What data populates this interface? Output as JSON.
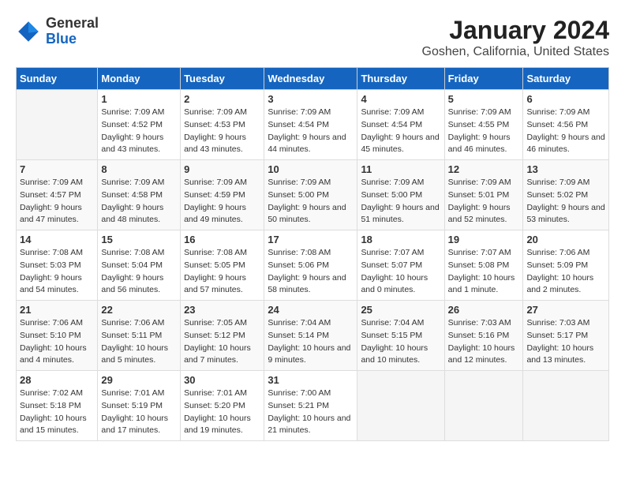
{
  "logo": {
    "general": "General",
    "blue": "Blue"
  },
  "title": "January 2024",
  "subtitle": "Goshen, California, United States",
  "headers": [
    "Sunday",
    "Monday",
    "Tuesday",
    "Wednesday",
    "Thursday",
    "Friday",
    "Saturday"
  ],
  "weeks": [
    [
      {
        "day": "",
        "sunrise": "",
        "sunset": "",
        "daylight": ""
      },
      {
        "day": "1",
        "sunrise": "Sunrise: 7:09 AM",
        "sunset": "Sunset: 4:52 PM",
        "daylight": "Daylight: 9 hours and 43 minutes."
      },
      {
        "day": "2",
        "sunrise": "Sunrise: 7:09 AM",
        "sunset": "Sunset: 4:53 PM",
        "daylight": "Daylight: 9 hours and 43 minutes."
      },
      {
        "day": "3",
        "sunrise": "Sunrise: 7:09 AM",
        "sunset": "Sunset: 4:54 PM",
        "daylight": "Daylight: 9 hours and 44 minutes."
      },
      {
        "day": "4",
        "sunrise": "Sunrise: 7:09 AM",
        "sunset": "Sunset: 4:54 PM",
        "daylight": "Daylight: 9 hours and 45 minutes."
      },
      {
        "day": "5",
        "sunrise": "Sunrise: 7:09 AM",
        "sunset": "Sunset: 4:55 PM",
        "daylight": "Daylight: 9 hours and 46 minutes."
      },
      {
        "day": "6",
        "sunrise": "Sunrise: 7:09 AM",
        "sunset": "Sunset: 4:56 PM",
        "daylight": "Daylight: 9 hours and 46 minutes."
      }
    ],
    [
      {
        "day": "7",
        "sunrise": "Sunrise: 7:09 AM",
        "sunset": "Sunset: 4:57 PM",
        "daylight": "Daylight: 9 hours and 47 minutes."
      },
      {
        "day": "8",
        "sunrise": "Sunrise: 7:09 AM",
        "sunset": "Sunset: 4:58 PM",
        "daylight": "Daylight: 9 hours and 48 minutes."
      },
      {
        "day": "9",
        "sunrise": "Sunrise: 7:09 AM",
        "sunset": "Sunset: 4:59 PM",
        "daylight": "Daylight: 9 hours and 49 minutes."
      },
      {
        "day": "10",
        "sunrise": "Sunrise: 7:09 AM",
        "sunset": "Sunset: 5:00 PM",
        "daylight": "Daylight: 9 hours and 50 minutes."
      },
      {
        "day": "11",
        "sunrise": "Sunrise: 7:09 AM",
        "sunset": "Sunset: 5:00 PM",
        "daylight": "Daylight: 9 hours and 51 minutes."
      },
      {
        "day": "12",
        "sunrise": "Sunrise: 7:09 AM",
        "sunset": "Sunset: 5:01 PM",
        "daylight": "Daylight: 9 hours and 52 minutes."
      },
      {
        "day": "13",
        "sunrise": "Sunrise: 7:09 AM",
        "sunset": "Sunset: 5:02 PM",
        "daylight": "Daylight: 9 hours and 53 minutes."
      }
    ],
    [
      {
        "day": "14",
        "sunrise": "Sunrise: 7:08 AM",
        "sunset": "Sunset: 5:03 PM",
        "daylight": "Daylight: 9 hours and 54 minutes."
      },
      {
        "day": "15",
        "sunrise": "Sunrise: 7:08 AM",
        "sunset": "Sunset: 5:04 PM",
        "daylight": "Daylight: 9 hours and 56 minutes."
      },
      {
        "day": "16",
        "sunrise": "Sunrise: 7:08 AM",
        "sunset": "Sunset: 5:05 PM",
        "daylight": "Daylight: 9 hours and 57 minutes."
      },
      {
        "day": "17",
        "sunrise": "Sunrise: 7:08 AM",
        "sunset": "Sunset: 5:06 PM",
        "daylight": "Daylight: 9 hours and 58 minutes."
      },
      {
        "day": "18",
        "sunrise": "Sunrise: 7:07 AM",
        "sunset": "Sunset: 5:07 PM",
        "daylight": "Daylight: 10 hours and 0 minutes."
      },
      {
        "day": "19",
        "sunrise": "Sunrise: 7:07 AM",
        "sunset": "Sunset: 5:08 PM",
        "daylight": "Daylight: 10 hours and 1 minute."
      },
      {
        "day": "20",
        "sunrise": "Sunrise: 7:06 AM",
        "sunset": "Sunset: 5:09 PM",
        "daylight": "Daylight: 10 hours and 2 minutes."
      }
    ],
    [
      {
        "day": "21",
        "sunrise": "Sunrise: 7:06 AM",
        "sunset": "Sunset: 5:10 PM",
        "daylight": "Daylight: 10 hours and 4 minutes."
      },
      {
        "day": "22",
        "sunrise": "Sunrise: 7:06 AM",
        "sunset": "Sunset: 5:11 PM",
        "daylight": "Daylight: 10 hours and 5 minutes."
      },
      {
        "day": "23",
        "sunrise": "Sunrise: 7:05 AM",
        "sunset": "Sunset: 5:12 PM",
        "daylight": "Daylight: 10 hours and 7 minutes."
      },
      {
        "day": "24",
        "sunrise": "Sunrise: 7:04 AM",
        "sunset": "Sunset: 5:14 PM",
        "daylight": "Daylight: 10 hours and 9 minutes."
      },
      {
        "day": "25",
        "sunrise": "Sunrise: 7:04 AM",
        "sunset": "Sunset: 5:15 PM",
        "daylight": "Daylight: 10 hours and 10 minutes."
      },
      {
        "day": "26",
        "sunrise": "Sunrise: 7:03 AM",
        "sunset": "Sunset: 5:16 PM",
        "daylight": "Daylight: 10 hours and 12 minutes."
      },
      {
        "day": "27",
        "sunrise": "Sunrise: 7:03 AM",
        "sunset": "Sunset: 5:17 PM",
        "daylight": "Daylight: 10 hours and 13 minutes."
      }
    ],
    [
      {
        "day": "28",
        "sunrise": "Sunrise: 7:02 AM",
        "sunset": "Sunset: 5:18 PM",
        "daylight": "Daylight: 10 hours and 15 minutes."
      },
      {
        "day": "29",
        "sunrise": "Sunrise: 7:01 AM",
        "sunset": "Sunset: 5:19 PM",
        "daylight": "Daylight: 10 hours and 17 minutes."
      },
      {
        "day": "30",
        "sunrise": "Sunrise: 7:01 AM",
        "sunset": "Sunset: 5:20 PM",
        "daylight": "Daylight: 10 hours and 19 minutes."
      },
      {
        "day": "31",
        "sunrise": "Sunrise: 7:00 AM",
        "sunset": "Sunset: 5:21 PM",
        "daylight": "Daylight: 10 hours and 21 minutes."
      },
      {
        "day": "",
        "sunrise": "",
        "sunset": "",
        "daylight": ""
      },
      {
        "day": "",
        "sunrise": "",
        "sunset": "",
        "daylight": ""
      },
      {
        "day": "",
        "sunrise": "",
        "sunset": "",
        "daylight": ""
      }
    ]
  ]
}
